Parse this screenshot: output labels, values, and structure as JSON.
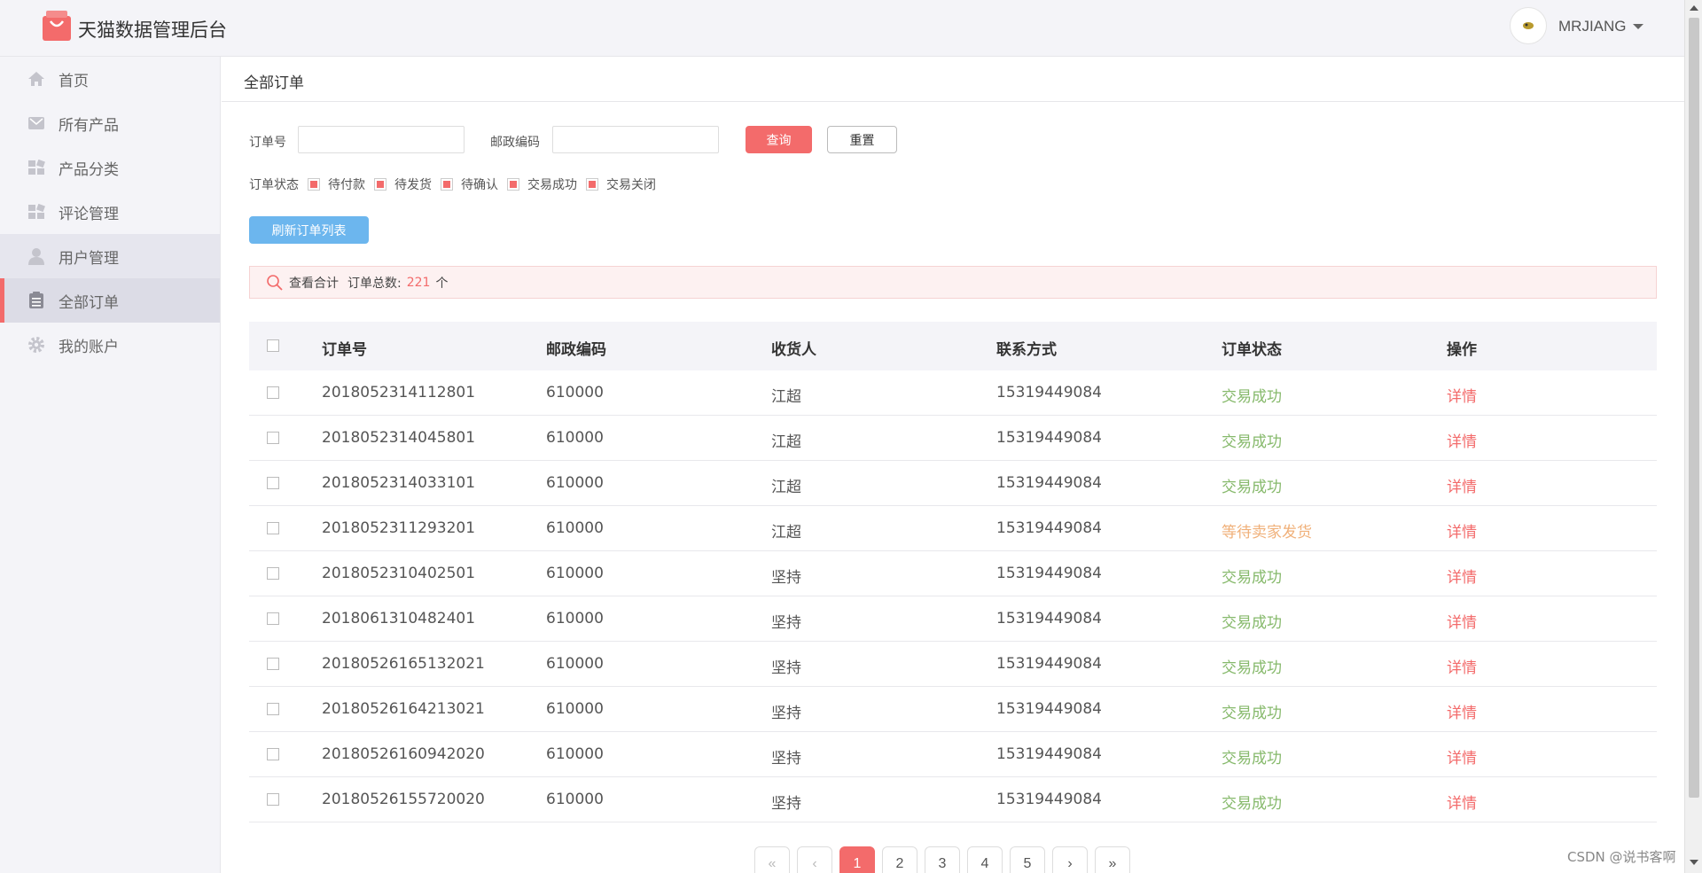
{
  "header": {
    "app_title": "天猫数据管理后台",
    "username": "MRJIANG",
    "logo_icon": "shopping-bag-icon"
  },
  "sidebar": {
    "items": [
      {
        "label": "首页",
        "icon": "home-icon"
      },
      {
        "label": "所有产品",
        "icon": "product-icon"
      },
      {
        "label": "产品分类",
        "icon": "category-icon"
      },
      {
        "label": "评论管理",
        "icon": "comment-icon"
      },
      {
        "label": "用户管理",
        "icon": "user-icon"
      },
      {
        "label": "全部订单",
        "icon": "order-icon"
      },
      {
        "label": "我的账户",
        "icon": "gear-icon"
      }
    ],
    "active_index": 5,
    "hover_index": 4
  },
  "breadcrumb": "全部订单",
  "filters": {
    "order_no_label": "订单号",
    "order_no_value": "",
    "postcode_label": "邮政编码",
    "postcode_value": "",
    "query_label": "查询",
    "reset_label": "重置",
    "status_label": "订单状态",
    "statuses": [
      "待付款",
      "待发货",
      "待确认",
      "交易成功",
      "交易关闭"
    ],
    "refresh_label": "刷新订单列表"
  },
  "summary": {
    "view_label": "查看合计",
    "total_label": "订单总数:",
    "total": "221",
    "unit": "个"
  },
  "table": {
    "columns": [
      "订单号",
      "邮政编码",
      "收货人",
      "联系方式",
      "订单状态",
      "操作"
    ],
    "rows": [
      {
        "order_no": "2018052314112801",
        "postcode": "610000",
        "receiver": "江超",
        "phone": "15319449084",
        "status": "交易成功",
        "action": "详情"
      },
      {
        "order_no": "2018052314045801",
        "postcode": "610000",
        "receiver": "江超",
        "phone": "15319449084",
        "status": "交易成功",
        "action": "详情"
      },
      {
        "order_no": "2018052314033101",
        "postcode": "610000",
        "receiver": "江超",
        "phone": "15319449084",
        "status": "交易成功",
        "action": "详情"
      },
      {
        "order_no": "2018052311293201",
        "postcode": "610000",
        "receiver": "江超",
        "phone": "15319449084",
        "status": "等待卖家发货",
        "action": "详情"
      },
      {
        "order_no": "2018052310402501",
        "postcode": "610000",
        "receiver": "坚持",
        "phone": "15319449084",
        "status": "交易成功",
        "action": "详情"
      },
      {
        "order_no": "2018061310482401",
        "postcode": "610000",
        "receiver": "坚持",
        "phone": "15319449084",
        "status": "交易成功",
        "action": "详情"
      },
      {
        "order_no": "20180526165132021",
        "postcode": "610000",
        "receiver": "坚持",
        "phone": "15319449084",
        "status": "交易成功",
        "action": "详情"
      },
      {
        "order_no": "20180526164213021",
        "postcode": "610000",
        "receiver": "坚持",
        "phone": "15319449084",
        "status": "交易成功",
        "action": "详情"
      },
      {
        "order_no": "20180526160942020",
        "postcode": "610000",
        "receiver": "坚持",
        "phone": "15319449084",
        "status": "交易成功",
        "action": "详情"
      },
      {
        "order_no": "20180526155720020",
        "postcode": "610000",
        "receiver": "坚持",
        "phone": "15319449084",
        "status": "交易成功",
        "action": "详情"
      }
    ]
  },
  "pagination": {
    "first": "«",
    "prev": "‹",
    "pages": [
      "1",
      "2",
      "3",
      "4",
      "5"
    ],
    "current": "1",
    "next": "›",
    "last": "»"
  },
  "watermark": "CSDN @说书客啊",
  "colors": {
    "accent": "#f36b6b",
    "success": "#86b96b",
    "pending": "#f0b079",
    "info": "#6cb6ee"
  }
}
